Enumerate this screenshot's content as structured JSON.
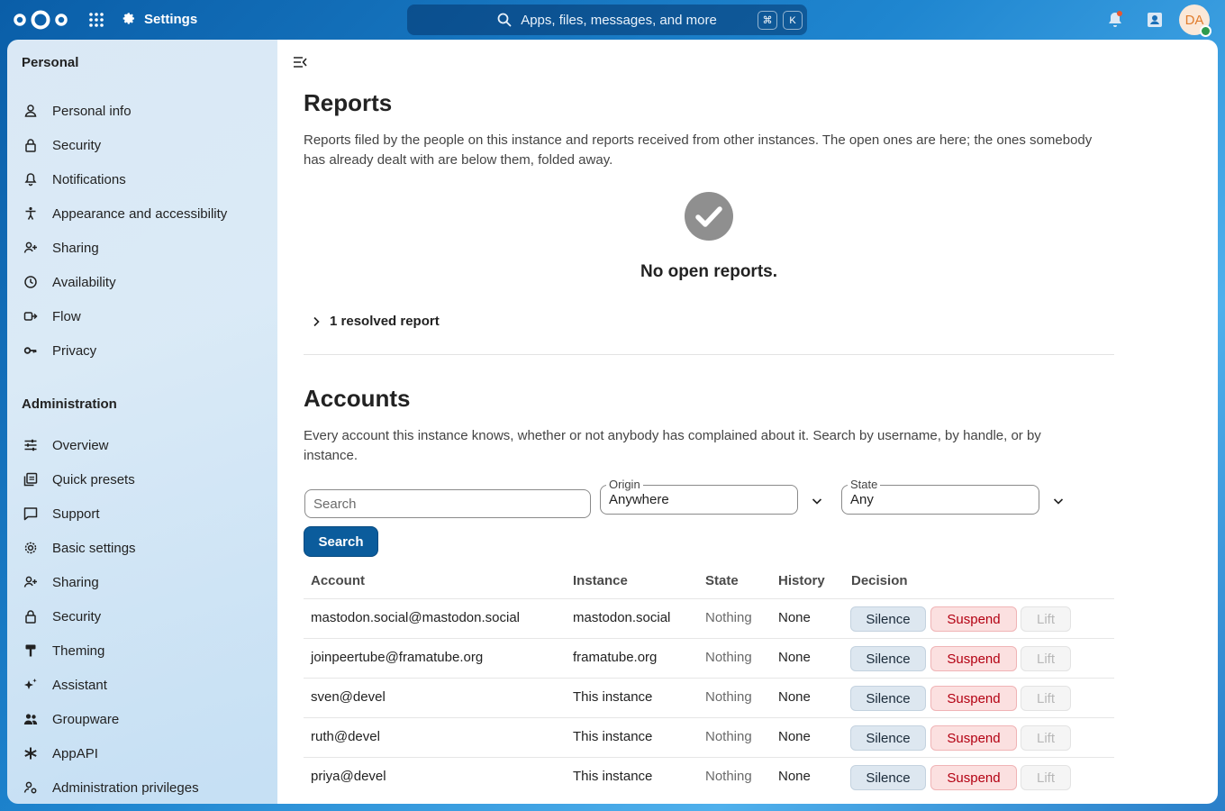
{
  "header": {
    "app_name": "Settings",
    "search_placeholder": "Apps, files, messages, and more",
    "shortcut_cmd": "⌘",
    "shortcut_key": "K",
    "avatar_initials": "DA"
  },
  "sidebar": {
    "personal_title": "Personal",
    "personal_items": [
      {
        "label": "Personal info",
        "icon": "user-icon"
      },
      {
        "label": "Security",
        "icon": "lock-icon"
      },
      {
        "label": "Notifications",
        "icon": "bell-icon"
      },
      {
        "label": "Appearance and accessibility",
        "icon": "accessibility-icon"
      },
      {
        "label": "Sharing",
        "icon": "share-user-icon"
      },
      {
        "label": "Availability",
        "icon": "clock-icon"
      },
      {
        "label": "Flow",
        "icon": "flow-icon"
      },
      {
        "label": "Privacy",
        "icon": "key-icon"
      }
    ],
    "admin_title": "Administration",
    "admin_items": [
      {
        "label": "Overview",
        "icon": "tune-icon"
      },
      {
        "label": "Quick presets",
        "icon": "presets-icon"
      },
      {
        "label": "Support",
        "icon": "support-icon"
      },
      {
        "label": "Basic settings",
        "icon": "gear-icon"
      },
      {
        "label": "Sharing",
        "icon": "share-user-icon"
      },
      {
        "label": "Security",
        "icon": "lock-icon"
      },
      {
        "label": "Theming",
        "icon": "brush-icon"
      },
      {
        "label": "Assistant",
        "icon": "sparkle-icon"
      },
      {
        "label": "Groupware",
        "icon": "group-icon"
      },
      {
        "label": "AppAPI",
        "icon": "api-icon"
      },
      {
        "label": "Administration privileges",
        "icon": "admin-user-icon"
      }
    ]
  },
  "reports": {
    "title": "Reports",
    "description": "Reports filed by the people on this instance and reports received from other instances. The open ones are here; the ones somebody has already dealt with are below them, folded away.",
    "empty_title": "No open reports.",
    "resolved_label": "1 resolved report"
  },
  "accounts": {
    "title": "Accounts",
    "description": "Every account this instance knows, whether or not anybody has complained about it. Search by username, by handle, or by instance.",
    "search_placeholder": "Search",
    "origin_label": "Origin",
    "origin_value": "Anywhere",
    "state_label": "State",
    "state_value": "Any",
    "search_button": "Search",
    "columns": [
      "Account",
      "Instance",
      "State",
      "History",
      "Decision"
    ],
    "actions": {
      "silence": "Silence",
      "suspend": "Suspend",
      "lift": "Lift"
    },
    "rows": [
      {
        "account": "mastodon.social@mastodon.social",
        "instance": "mastodon.social",
        "state": "Nothing",
        "history": "None"
      },
      {
        "account": "joinpeertube@framatube.org",
        "instance": "framatube.org",
        "state": "Nothing",
        "history": "None"
      },
      {
        "account": "sven@devel",
        "instance": "This instance",
        "state": "Nothing",
        "history": "None"
      },
      {
        "account": "ruth@devel",
        "instance": "This instance",
        "state": "Nothing",
        "history": "None"
      },
      {
        "account": "priya@devel",
        "instance": "This instance",
        "state": "Nothing",
        "history": "None"
      }
    ]
  },
  "colors": {
    "header_blue": "#0a5ea8",
    "primary_button": "#0b5c9c",
    "suspend_text": "#b30012",
    "status_online": "#2d9b4e"
  }
}
